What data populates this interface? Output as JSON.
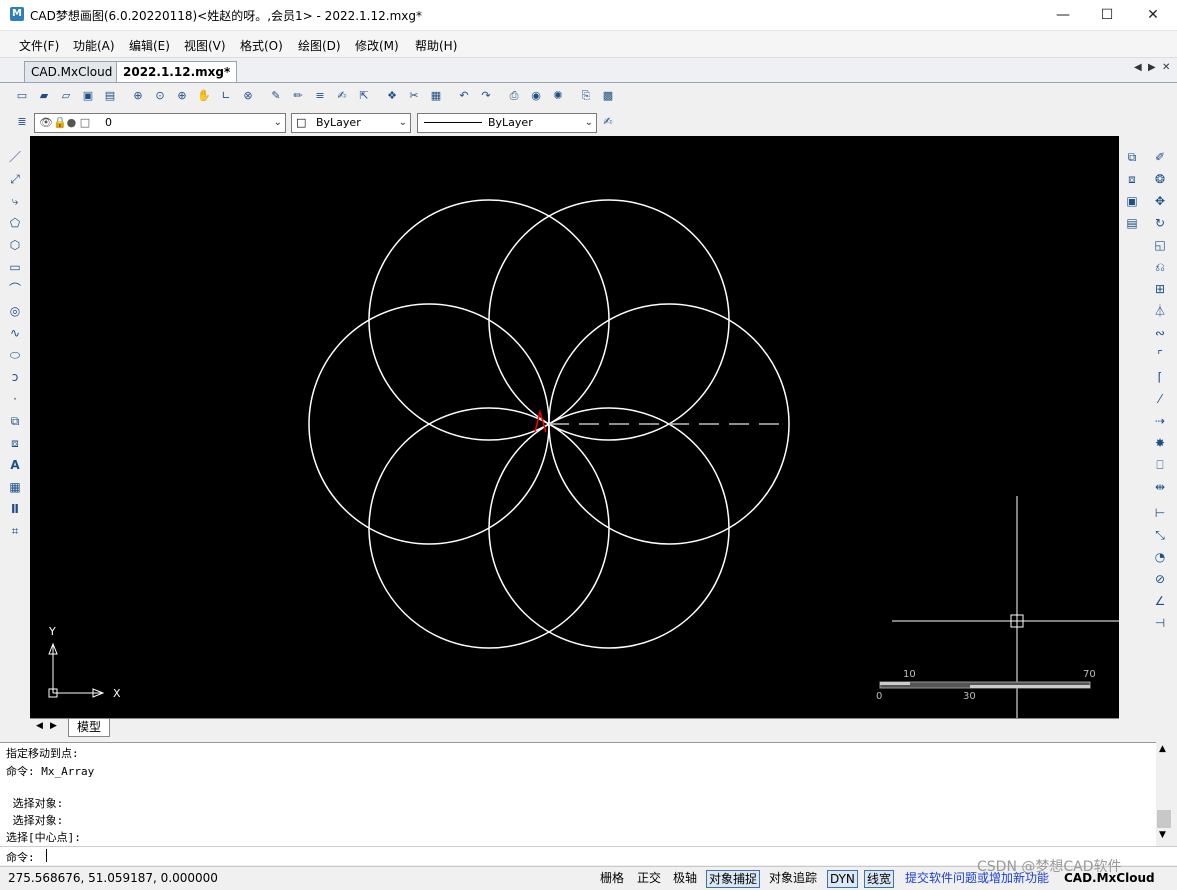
{
  "window": {
    "title": "CAD梦想画图(6.0.20220118)<姓赵的呀。,会员1> - 2022.1.12.mxg*",
    "logo_text": "M",
    "minimize": "—",
    "maximize": "☐",
    "close": "✕"
  },
  "menu": {
    "items": [
      "文件(F)",
      "功能(A)",
      "编辑(E)",
      "视图(V)",
      "格式(O)",
      "绘图(D)",
      "修改(M)",
      "帮助(H)"
    ]
  },
  "tabs": {
    "items": [
      {
        "label": "CAD.MxCloud",
        "active": false
      },
      {
        "label": "2022.1.12.mxg*",
        "active": true
      }
    ]
  },
  "layer_bar": {
    "layer_value": "0",
    "color_value": "ByLayer",
    "linetype_value": "ByLayer"
  },
  "canvas": {
    "ucs_x_label": "X",
    "ucs_y_label": "Y",
    "scale_labels": [
      "10",
      "70",
      "0",
      "30"
    ],
    "layout_tab": "模型"
  },
  "command": {
    "history": [
      "指定移动到点:",
      "命令: Mx_Array",
      "",
      " 选择对象:",
      " 选择对象:",
      "选择[中心点]:"
    ],
    "prompt": "命令:"
  },
  "status": {
    "coords": "275.568676,  51.059187,  0.000000",
    "toggles": [
      {
        "label": "栅格",
        "on": false
      },
      {
        "label": "正交",
        "on": false
      },
      {
        "label": "极轴",
        "on": false
      },
      {
        "label": "对象捕捉",
        "on": true
      },
      {
        "label": "对象追踪",
        "on": false
      },
      {
        "label": "DYN",
        "on": true
      },
      {
        "label": "线宽",
        "on": true
      }
    ],
    "feedback_link": "提交软件问题或增加新功能",
    "brand": "CAD.MxCloud",
    "watermark": "CSDN @梦想CAD软件"
  },
  "colors": {
    "canvas_bg": "#000000",
    "geometry": "#ffffff",
    "highlight": "#ff0000",
    "link": "#1a3fd6"
  }
}
